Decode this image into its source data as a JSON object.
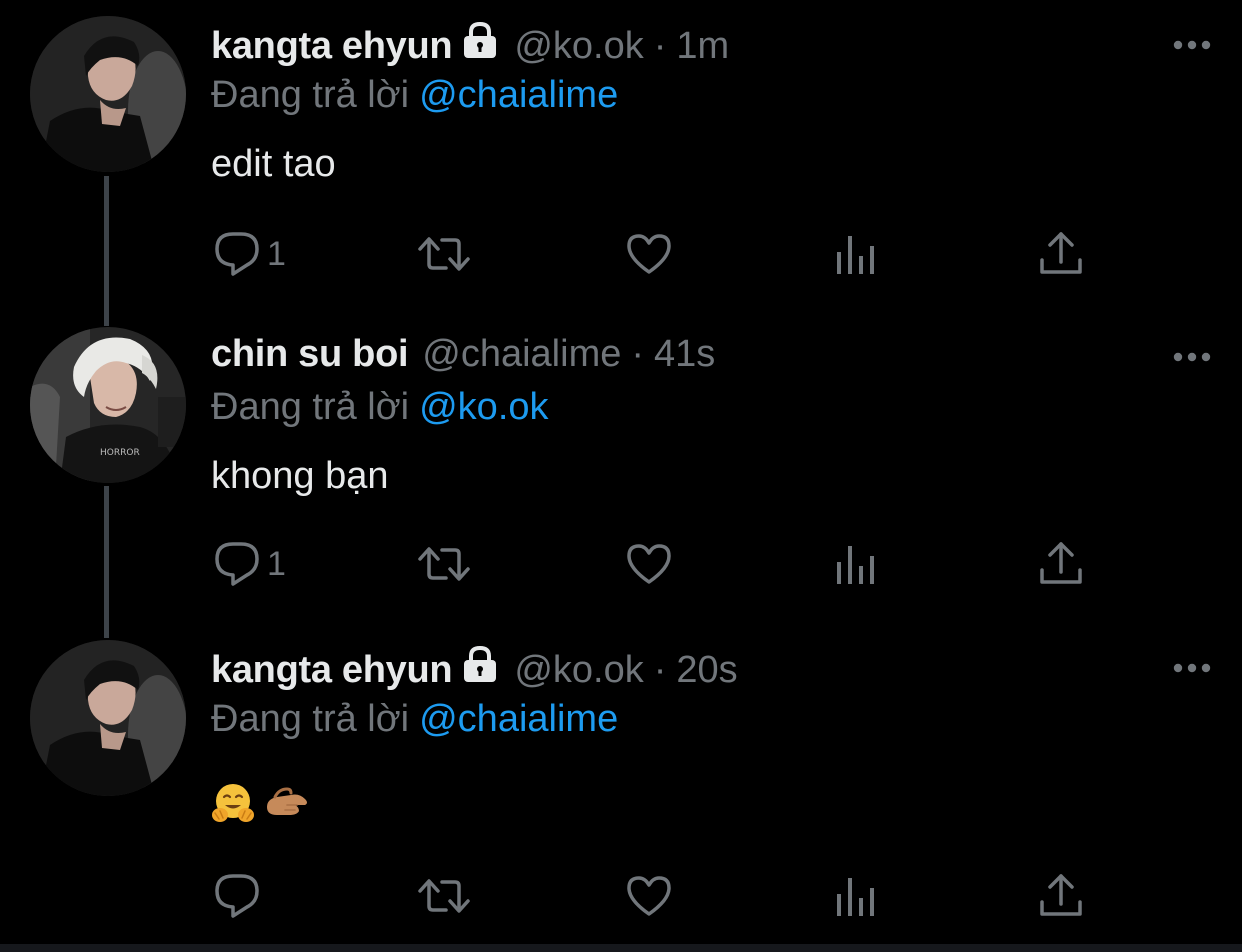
{
  "tweets": [
    {
      "display_name": "kangta ehyun",
      "locked": true,
      "handle": "@ko.ok",
      "separator": "·",
      "time": "1m",
      "reply_prefix": "Đang trả lời",
      "reply_to": "@chaialime",
      "text": "edit tao",
      "reply_count": "1",
      "avatar": "avatar-dark-hair"
    },
    {
      "display_name": "chin su boi",
      "locked": false,
      "handle": "@chaialime",
      "separator": "·",
      "time": "41s",
      "reply_prefix": "Đang trả lời",
      "reply_to": "@ko.ok",
      "text": "khong bạn",
      "reply_count": "1",
      "avatar": "avatar-light-hair"
    },
    {
      "display_name": "kangta ehyun",
      "locked": true,
      "handle": "@ko.ok",
      "separator": "·",
      "time": "20s",
      "reply_prefix": "Đang trả lời",
      "reply_to": "@chaialime",
      "text": "",
      "emojis": [
        "hugging-face-emoji",
        "palm-right-hand-emoji"
      ],
      "reply_count": "",
      "avatar": "avatar-dark-hair"
    }
  ],
  "icons": {
    "reply": "reply-icon",
    "retweet": "retweet-icon",
    "like": "heart-icon",
    "views": "views-icon",
    "share": "share-icon",
    "more": "more-icon",
    "lock": "lock-icon"
  },
  "colors": {
    "background": "#000000",
    "primary_text": "#e7e9ea",
    "secondary_text": "#71767b",
    "accent": "#1d9bf0",
    "thread_line": "#3d4349"
  }
}
